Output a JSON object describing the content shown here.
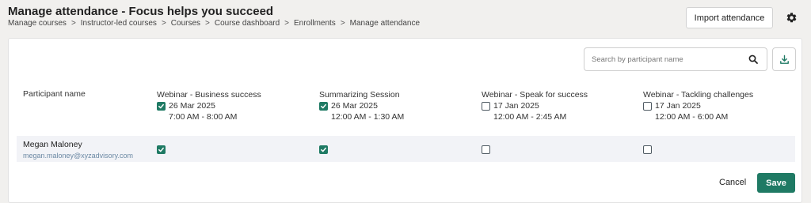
{
  "header": {
    "title": "Manage attendance - Focus helps you succeed",
    "breadcrumb": [
      "Manage courses",
      "Instructor-led courses",
      "Courses",
      "Course dashboard",
      "Enrollments",
      "Manage attendance"
    ],
    "breadcrumb_separator": ">",
    "import_label": "Import attendance"
  },
  "toolbar": {
    "search_placeholder": "Search by participant name",
    "search_value": ""
  },
  "table": {
    "participant_header": "Participant name",
    "sessions": [
      {
        "name": "Webinar - Business success",
        "date": "26 Mar 2025",
        "time": "7:00 AM - 8:00 AM",
        "checked": true
      },
      {
        "name": "Summarizing Session",
        "date": "26 Mar 2025",
        "time": "12:00 AM - 1:30 AM",
        "checked": true
      },
      {
        "name": "Webinar - Speak for success",
        "date": "17 Jan 2025",
        "time": "12:00 AM - 2:45 AM",
        "checked": false
      },
      {
        "name": "Webinar - Tackling challenges",
        "date": "17 Jan 2025",
        "time": "12:00 AM - 6:00 AM",
        "checked": false
      }
    ],
    "participants": [
      {
        "name": "Megan Maloney",
        "email": "megan.maloney@xyzadvisory.com",
        "attendance": [
          true,
          true,
          false,
          false
        ]
      }
    ]
  },
  "footer": {
    "cancel_label": "Cancel",
    "save_label": "Save"
  },
  "colors": {
    "accent": "#1f7a64",
    "email_link": "#6c89a4",
    "background": "#f1f0ee"
  }
}
